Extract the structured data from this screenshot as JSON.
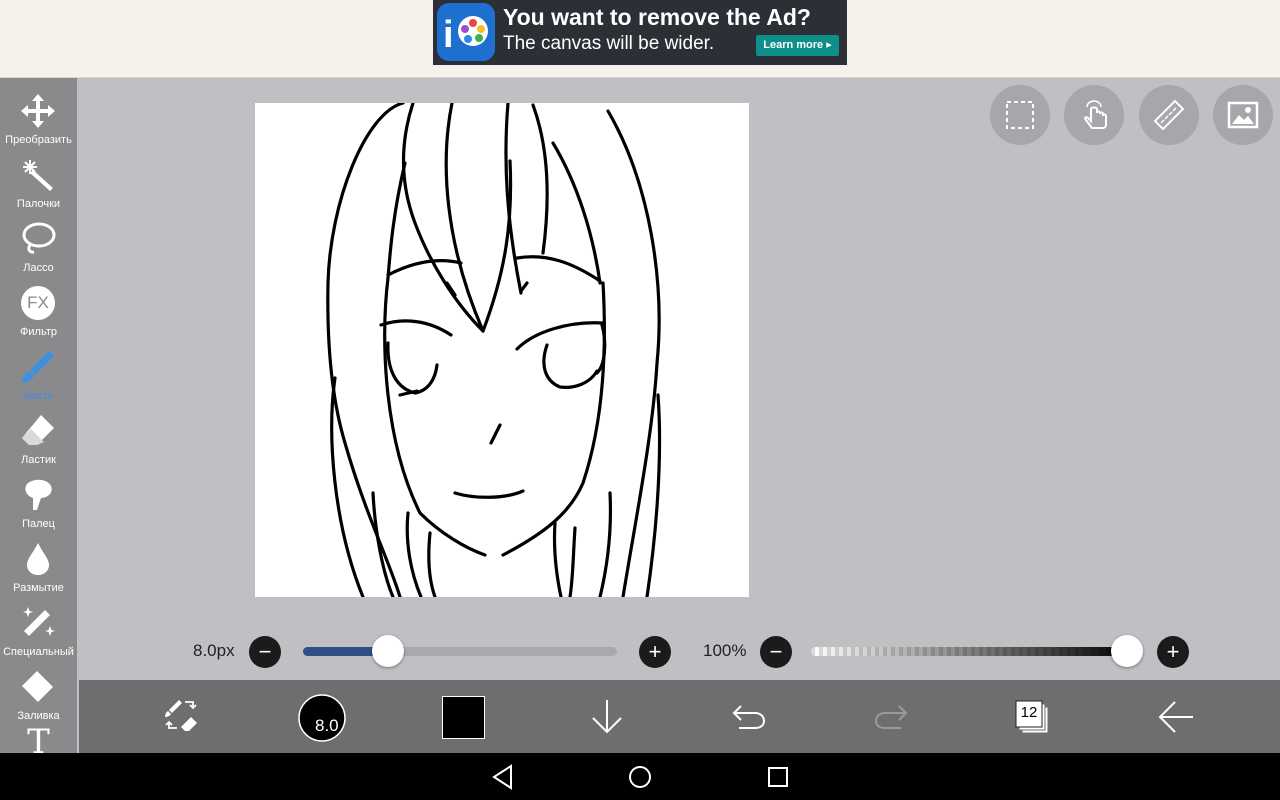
{
  "ad": {
    "title": "You want to remove the Ad?",
    "subtitle": "The canvas will be wider.",
    "cta": "Learn more ▸"
  },
  "tools": [
    {
      "label": "Преобразить",
      "icon": "transform-icon"
    },
    {
      "label": "Палочки",
      "icon": "magic-wand-icon"
    },
    {
      "label": "Лассо",
      "icon": "lasso-icon"
    },
    {
      "label": "Фильтр",
      "icon": "fx-filter-icon",
      "glyph": "FX"
    },
    {
      "label": "Кисть",
      "icon": "brush-icon",
      "active": true
    },
    {
      "label": "Ластик",
      "icon": "eraser-icon"
    },
    {
      "label": "Палец",
      "icon": "smudge-icon"
    },
    {
      "label": "Размытие",
      "icon": "blur-drop-icon"
    },
    {
      "label": "Специальный",
      "icon": "special-brush-icon"
    },
    {
      "label": "Заливка",
      "icon": "fill-bucket-icon"
    },
    {
      "label": "",
      "icon": "text-icon",
      "glyph": "T"
    }
  ],
  "brush": {
    "size_label": "8.0px",
    "size_fraction": 0.27,
    "opacity_label": "100%",
    "opacity_fraction": 1.0,
    "preview_value": "8.0",
    "color": "#000000"
  },
  "layers": {
    "count": "12"
  },
  "colors": {
    "accent": "#3d8fe0",
    "slider_fill": "#2f4f86",
    "toolbar": "#8a8a8c",
    "bottom_toolbar": "#6e6e70"
  }
}
